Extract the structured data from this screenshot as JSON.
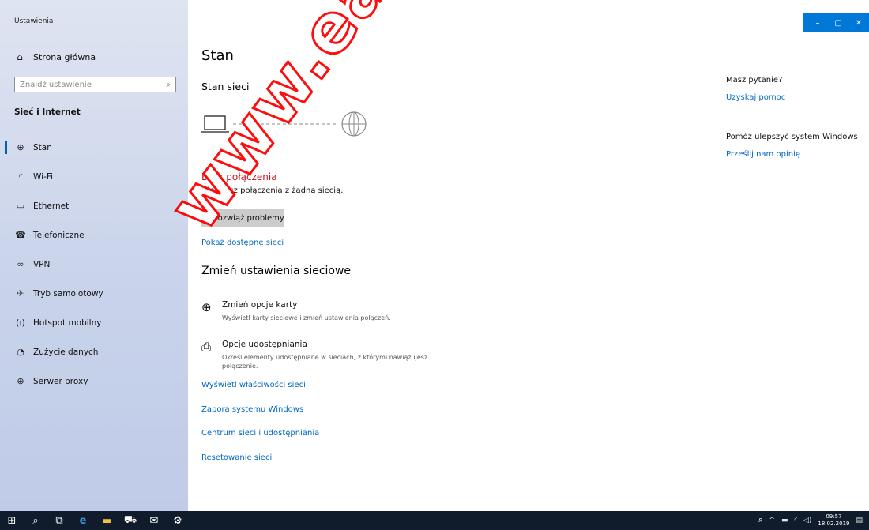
{
  "app": {
    "title": "Ustawienia"
  },
  "window_controls": {
    "minimize": "–",
    "maximize": "▢",
    "close": "✕"
  },
  "sidebar": {
    "home_label": "Strona główna",
    "search_placeholder": "Znajdź ustawienie",
    "section_title": "Sieć i Internet",
    "items": [
      {
        "label": "Stan",
        "icon": "status-icon",
        "glyph": "⊕",
        "active": true
      },
      {
        "label": "Wi-Fi",
        "icon": "wifi-icon",
        "glyph": "◜"
      },
      {
        "label": "Ethernet",
        "icon": "ethernet-icon",
        "glyph": "▭"
      },
      {
        "label": "Telefoniczne",
        "icon": "dialup-icon",
        "glyph": "☎"
      },
      {
        "label": "VPN",
        "icon": "vpn-icon",
        "glyph": "∞"
      },
      {
        "label": "Tryb samolotowy",
        "icon": "airplane-icon",
        "glyph": "✈"
      },
      {
        "label": "Hotspot mobilny",
        "icon": "hotspot-icon",
        "glyph": "(ı)"
      },
      {
        "label": "Zużycie danych",
        "icon": "data-usage-icon",
        "glyph": "◔"
      },
      {
        "label": "Serwer proxy",
        "icon": "globe-icon",
        "glyph": "⊕"
      }
    ]
  },
  "main": {
    "title": "Stan",
    "status_heading": "Stan sieci",
    "error_title": "Brak połączenia",
    "error_desc": "Nie masz połączenia z żadną siecią.",
    "troubleshoot_label": "Rozwiąż problemy",
    "show_networks_link": "Pokaż dostępne sieci",
    "change_heading": "Zmień ustawienia sieciowe",
    "options": [
      {
        "title": "Zmień opcje karty",
        "desc": "Wyświetl karty sieciowe i zmień ustawienia połączeń.",
        "icon": "adapter-icon",
        "glyph": "⊕"
      },
      {
        "title": "Opcje udostępniania",
        "desc": "Określ elementy udostępniane w sieciach, z którymi nawiązujesz połączenie.",
        "icon": "sharing-icon",
        "glyph": "⎙"
      }
    ],
    "links": [
      "Wyświetl właściwości sieci",
      "Zapora systemu Windows",
      "Centrum sieci i udostępniania",
      "Resetowanie sieci"
    ]
  },
  "right": {
    "question": "Masz pytanie?",
    "help_link": "Uzyskaj pomoc",
    "improve": "Pomóż ulepszyć system Windows",
    "feedback_link": "Prześlij nam opinię"
  },
  "watermark": {
    "text": "www.easy-c"
  },
  "taskbar": {
    "icons": [
      "windows-start-icon",
      "search-icon",
      "task-view-icon",
      "edge-icon",
      "file-explorer-icon",
      "store-icon",
      "mail-icon",
      "settings-icon"
    ],
    "time": "09:57",
    "date": "18.02.2019"
  }
}
